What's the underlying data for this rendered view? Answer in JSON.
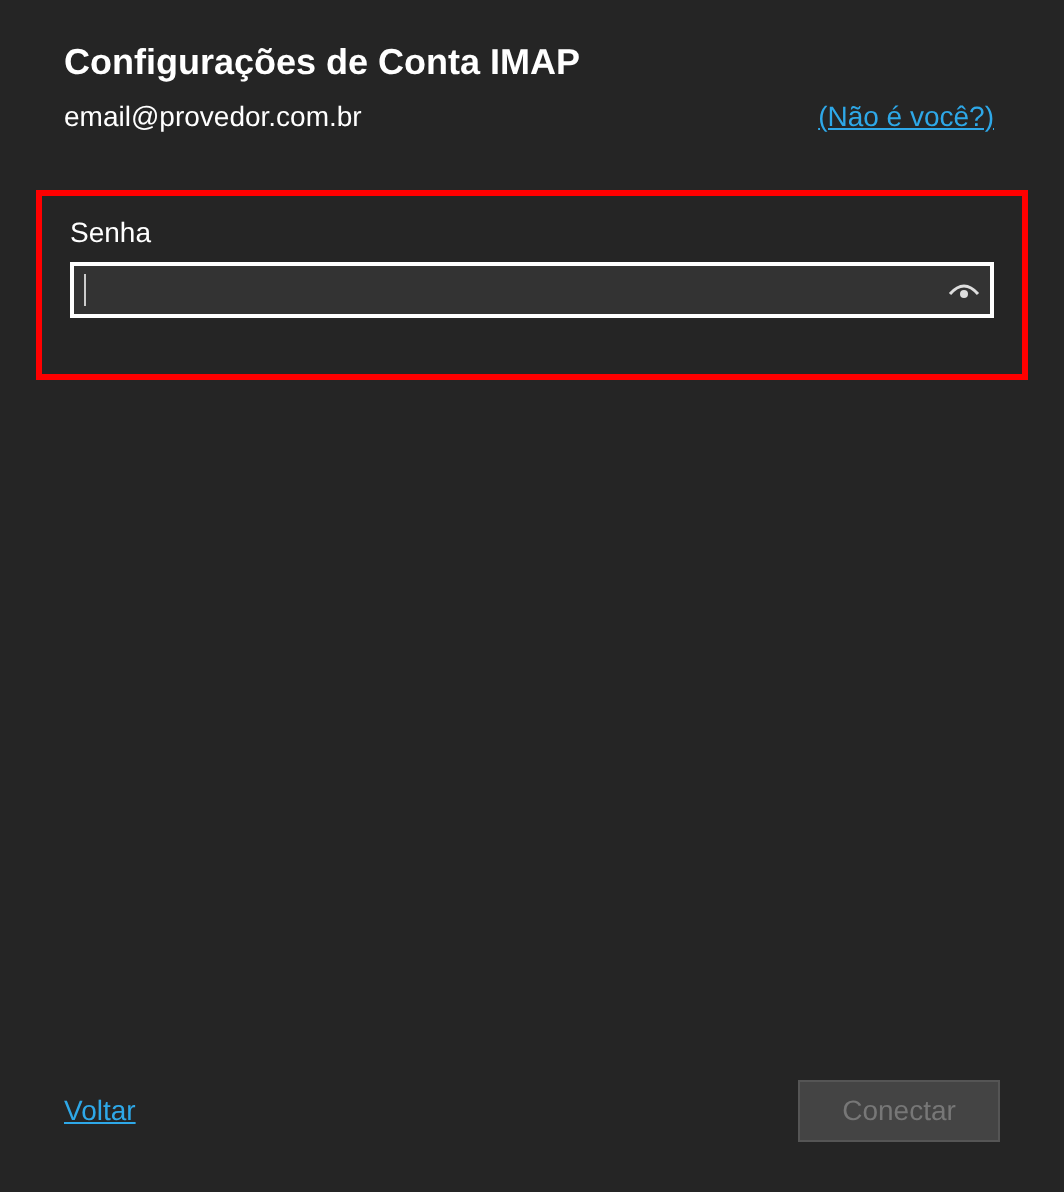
{
  "title": "Configurações de Conta IMAP",
  "account": {
    "email": "email@provedor.com.br",
    "link": "(Não é você?)"
  },
  "password": {
    "label": "Senha",
    "focused": true,
    "highlighted": true
  },
  "back_link": "Voltar",
  "connect_button": {
    "label": "Conectar",
    "disabled": true
  }
}
